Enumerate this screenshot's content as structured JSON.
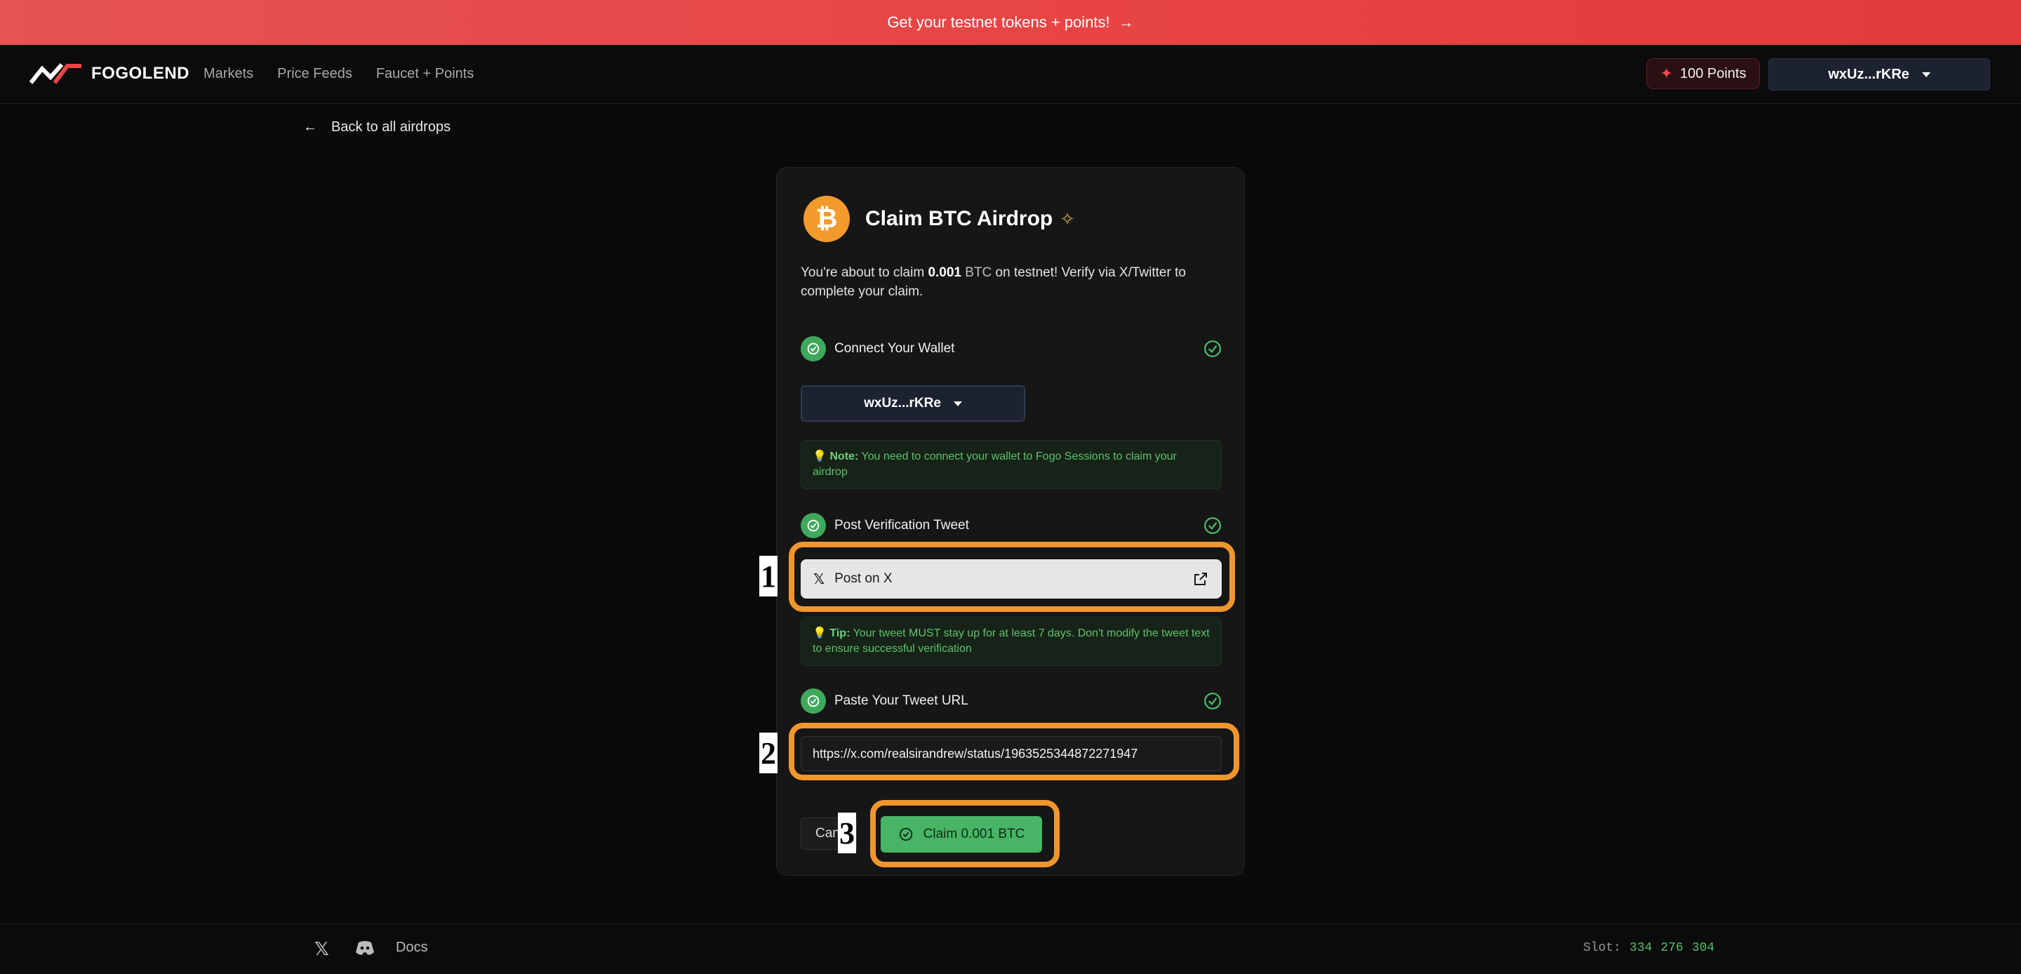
{
  "banner": {
    "text": "Get your testnet tokens + points!",
    "arrow": "→"
  },
  "nav": {
    "brand": "FOGOLEND",
    "links": [
      "Markets",
      "Price Feeds",
      "Faucet + Points"
    ],
    "points_label": "100 Points",
    "wallet_label": "wxUz...rKRe"
  },
  "back_link": "Back to all airdrops",
  "card": {
    "icon_glyph": "₿",
    "title": "Claim BTC Airdrop",
    "desc_prefix": "You're about to claim ",
    "desc_amount": "0.001",
    "desc_unit": "BTC",
    "desc_suffix": " on testnet! Verify via X/Twitter to complete your claim.",
    "steps": [
      {
        "label": "Connect Your Wallet"
      },
      {
        "label": "Post Verification Tweet"
      },
      {
        "label": "Paste Your Tweet URL"
      }
    ],
    "wallet_button": "wxUz...rKRe",
    "note_title": "Note:",
    "note_text": "You need to connect your wallet to Fogo Sessions to claim your airdrop",
    "post_button": "Post on X",
    "tip_title": "Tip:",
    "tip_text": "Your tweet MUST stay up for at least 7 days. Don't modify the tweet text to ensure successful verification",
    "tweet_url": "https://x.com/realsirandrew/status/1963525344872271947",
    "cancel_button": "Cancel",
    "claim_button": "Claim 0.001 BTC"
  },
  "annotations": [
    "1",
    "2",
    "3"
  ],
  "footer": {
    "docs": "Docs",
    "slot_label": "Slot:",
    "slot_parts": [
      "334",
      "276",
      "304"
    ]
  },
  "colors": {
    "accent_red": "#e84545",
    "success_green": "#47b565",
    "annotation_orange": "#f0962c",
    "btc_orange": "#f39a2d"
  }
}
